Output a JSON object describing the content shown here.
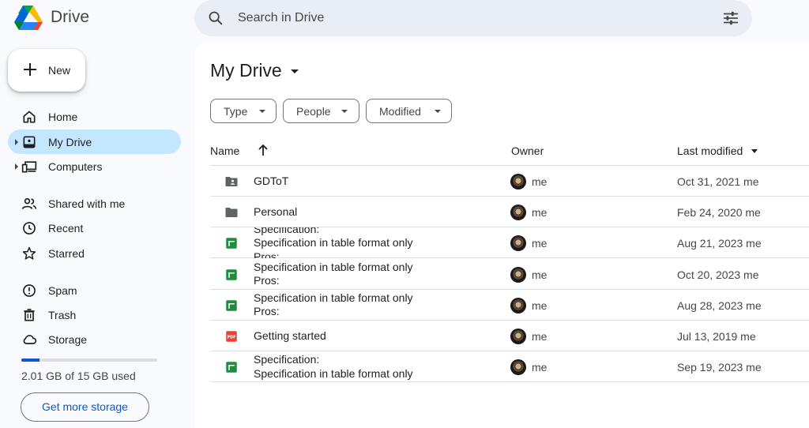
{
  "app": {
    "name": "Drive"
  },
  "search": {
    "placeholder": "Search in Drive"
  },
  "sidebar": {
    "new_label": "New",
    "items": [
      {
        "label": "Home",
        "icon": "home-icon"
      },
      {
        "label": "My Drive",
        "icon": "my-drive-icon",
        "active": true
      },
      {
        "label": "Computers",
        "icon": "computers-icon"
      },
      {
        "label": "Shared with me",
        "icon": "shared-icon"
      },
      {
        "label": "Recent",
        "icon": "clock-icon"
      },
      {
        "label": "Starred",
        "icon": "star-icon"
      },
      {
        "label": "Spam",
        "icon": "spam-icon"
      },
      {
        "label": "Trash",
        "icon": "trash-icon"
      },
      {
        "label": "Storage",
        "icon": "cloud-icon"
      }
    ],
    "storage": {
      "used_text": "2.01 GB of 15 GB used",
      "used_fraction": 0.134,
      "button": "Get more storage"
    }
  },
  "main": {
    "title": "My Drive",
    "filters": [
      "Type",
      "People",
      "Modified"
    ],
    "columns": {
      "name": "Name",
      "owner": "Owner",
      "modified": "Last modified"
    },
    "rows": [
      {
        "type": "shared-folder",
        "lines": [
          "GDToT"
        ],
        "owner": "me",
        "modified": "Oct 31, 2021 me"
      },
      {
        "type": "folder",
        "lines": [
          "Personal"
        ],
        "owner": "me",
        "modified": "Feb 24, 2020 me"
      },
      {
        "type": "sheet",
        "lines": [
          "Specification:",
          "Specification in table format only",
          "Pros:"
        ],
        "owner": "me",
        "modified": "Aug 21, 2023 me"
      },
      {
        "type": "sheet",
        "lines": [
          "Specification in table format only",
          "Pros:"
        ],
        "owner": "me",
        "modified": "Oct 20, 2023 me"
      },
      {
        "type": "sheet",
        "lines": [
          "Specification in table format only",
          "Pros:"
        ],
        "owner": "me",
        "modified": "Aug 28, 2023 me"
      },
      {
        "type": "pdf",
        "lines": [
          "Getting started"
        ],
        "owner": "me",
        "modified": "Jul 13, 2019 me"
      },
      {
        "type": "sheet",
        "lines": [
          "Specification:",
          "Specification in table format only"
        ],
        "owner": "me",
        "modified": "Sep 19, 2023 me"
      }
    ]
  },
  "colors": {
    "accent": "#0b57d0",
    "active_nav": "#c2e7ff",
    "sheet_green": "#1e8e3e",
    "pdf_red": "#ea4335"
  }
}
